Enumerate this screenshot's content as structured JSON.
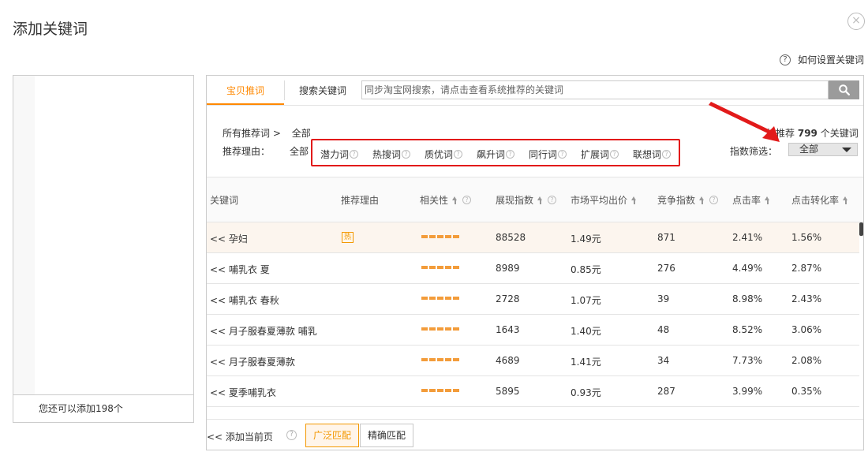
{
  "dialog": {
    "title": "添加关键词",
    "close": "×"
  },
  "help": {
    "icon": "?",
    "label": "如何设置关键词"
  },
  "left_panel": {
    "footer": "您还可以添加198个"
  },
  "tabs": [
    {
      "label": "宝贝推词",
      "active": true
    },
    {
      "label": "搜索关键词",
      "active": false
    }
  ],
  "search": {
    "placeholder": "同步淘宝网搜索，请点击查看系统推荐的关键词"
  },
  "filters": {
    "crumb_label": "所有推荐词 >",
    "crumb_value": "全部",
    "reason_label": "推荐理由：",
    "reason_all": "全部",
    "reasons": [
      "潜力词",
      "热搜词",
      "质优词",
      "飙升词",
      "同行词",
      "扩展词",
      "联想词"
    ],
    "recommend_prefix": "统推荐",
    "recommend_count": "799",
    "recommend_suffix": "个关键词",
    "index_filter_label": "指数筛选：",
    "index_filter_value": "全部"
  },
  "table": {
    "headers": {
      "keyword": "关键词",
      "reason": "推荐理由",
      "relevance": "相关性",
      "impressions": "展现指数",
      "avg_bid": "市场平均出价",
      "competition": "竞争指数",
      "ctr": "点击率",
      "cvr": "点击转化率"
    },
    "hot_badge": "热",
    "rows": [
      {
        "keyword": "<< 孕妇",
        "hot": true,
        "relevance": 5,
        "impressions": "88528",
        "avg_bid": "1.49元",
        "competition": "871",
        "ctr": "2.41%",
        "cvr": "1.56%"
      },
      {
        "keyword": "<< 哺乳衣 夏",
        "hot": false,
        "relevance": 5,
        "impressions": "8989",
        "avg_bid": "0.85元",
        "competition": "276",
        "ctr": "4.49%",
        "cvr": "2.87%"
      },
      {
        "keyword": "<< 哺乳衣 春秋",
        "hot": false,
        "relevance": 5,
        "impressions": "2728",
        "avg_bid": "1.07元",
        "competition": "39",
        "ctr": "8.98%",
        "cvr": "2.43%"
      },
      {
        "keyword": "<< 月子服春夏薄款 哺乳",
        "hot": false,
        "relevance": 5,
        "impressions": "1643",
        "avg_bid": "1.40元",
        "competition": "48",
        "ctr": "8.52%",
        "cvr": "3.06%"
      },
      {
        "keyword": "<< 月子服春夏薄款",
        "hot": false,
        "relevance": 5,
        "impressions": "4689",
        "avg_bid": "1.41元",
        "competition": "34",
        "ctr": "7.73%",
        "cvr": "2.08%"
      },
      {
        "keyword": "<< 夏季哺乳衣",
        "hot": false,
        "relevance": 5,
        "impressions": "5895",
        "avg_bid": "0.93元",
        "competition": "287",
        "ctr": "3.99%",
        "cvr": "0.35%"
      }
    ]
  },
  "bottom": {
    "add_page": "<< 添加当前页",
    "help_icon": "?",
    "broad_match": "广泛匹配",
    "exact_match": "精确匹配"
  },
  "colors": {
    "accent": "#ff8800",
    "annotation": "#e21a1a"
  }
}
